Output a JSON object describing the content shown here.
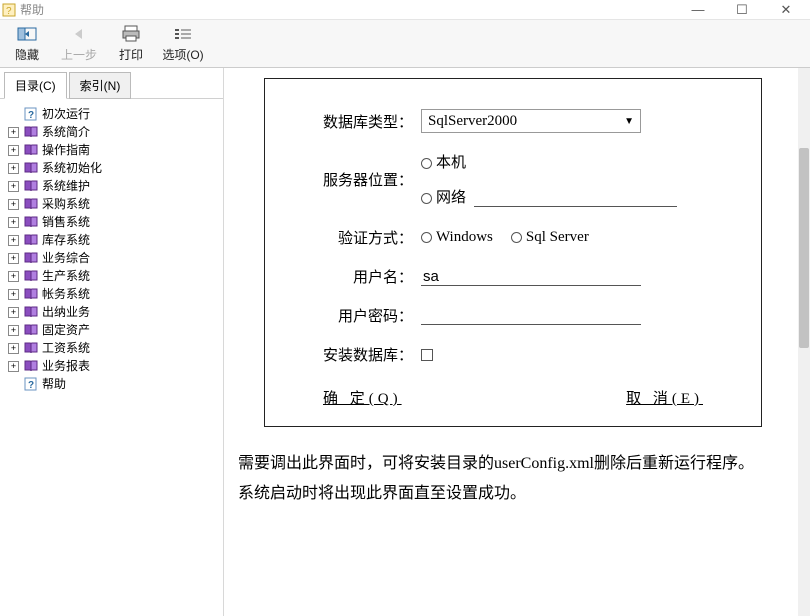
{
  "window": {
    "title": "帮助",
    "min": "—",
    "max": "☐",
    "close": "✕"
  },
  "toolbar": {
    "hide_label": "隐藏",
    "back_label": "上一步",
    "print_label": "打印",
    "options_label": "选项(O)"
  },
  "tabs": {
    "toc": "目录(C)",
    "index": "索引(N)"
  },
  "tree": {
    "items": [
      {
        "expandable": false,
        "iconType": "q",
        "label": "初次运行"
      },
      {
        "expandable": true,
        "iconType": "b",
        "label": "系统简介"
      },
      {
        "expandable": true,
        "iconType": "b",
        "label": "操作指南"
      },
      {
        "expandable": true,
        "iconType": "b",
        "label": "系统初始化"
      },
      {
        "expandable": true,
        "iconType": "b",
        "label": "系统维护"
      },
      {
        "expandable": true,
        "iconType": "b",
        "label": "采购系统"
      },
      {
        "expandable": true,
        "iconType": "b",
        "label": "销售系统"
      },
      {
        "expandable": true,
        "iconType": "b",
        "label": "库存系统"
      },
      {
        "expandable": true,
        "iconType": "b",
        "label": "业务综合"
      },
      {
        "expandable": true,
        "iconType": "b",
        "label": "生产系统"
      },
      {
        "expandable": true,
        "iconType": "b",
        "label": "帐务系统"
      },
      {
        "expandable": true,
        "iconType": "b",
        "label": "出纳业务"
      },
      {
        "expandable": true,
        "iconType": "b",
        "label": "固定资产"
      },
      {
        "expandable": true,
        "iconType": "b",
        "label": "工资系统"
      },
      {
        "expandable": true,
        "iconType": "b",
        "label": "业务报表"
      },
      {
        "expandable": false,
        "iconType": "q",
        "label": "帮助"
      }
    ]
  },
  "form": {
    "dbtype_label": "数据库类型：",
    "dbtype_value": "SqlServer2000",
    "serverpos_label": "服务器位置：",
    "serverpos_opt_local": "本机",
    "serverpos_opt_net": "网络",
    "auth_label": "验证方式：",
    "auth_opt_win": "Windows",
    "auth_opt_sql": "Sql Server",
    "user_label": "用户名：",
    "user_value": "sa",
    "pwd_label": "用户密码：",
    "installdb_label": "安装数据库：",
    "ok": "确 定(Q)",
    "cancel": "取 消(E)"
  },
  "paragraphs": {
    "p1": "需要调出此界面时，可将安装目录的userConfig.xml删除后重新运行程序。",
    "p2": "系统启动时将出现此界面直至设置成功。"
  }
}
